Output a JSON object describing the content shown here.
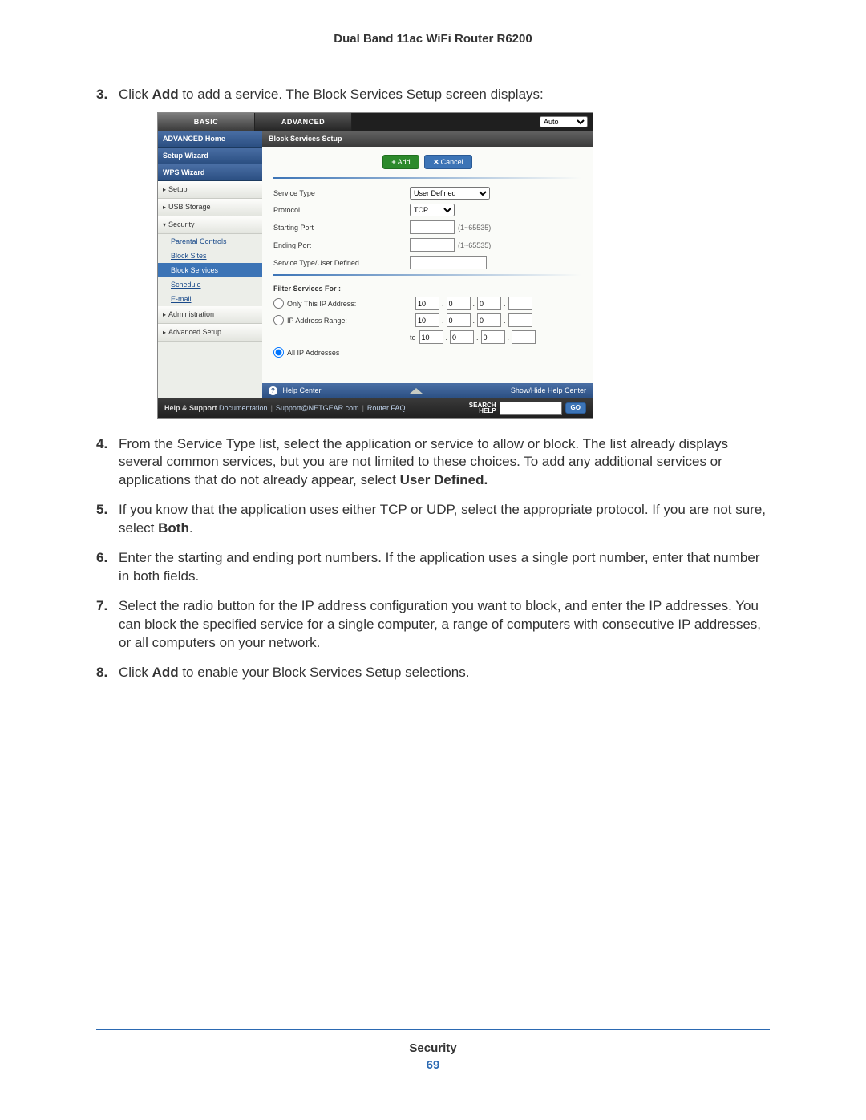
{
  "doc": {
    "title": "Dual Band 11ac WiFi Router R6200",
    "footer_section": "Security",
    "page_number": "69"
  },
  "steps": {
    "s3_num": "3.",
    "s3_a": "Click ",
    "s3_b": "Add",
    "s3_c": " to add a service. The Block Services Setup screen displays:",
    "s4_num": "4.",
    "s4_a": "From the Service Type list, select the application or service to allow or block. The list already displays several common services, but you are not limited to these choices. To add any additional services or applications that do not already appear, select ",
    "s4_b": "User Defined.",
    "s5_num": "5.",
    "s5_a": "If you know that the application uses either TCP or UDP, select the appropriate protocol. If you are not sure, select ",
    "s5_b": "Both",
    "s5_c": ".",
    "s6_num": "6.",
    "s6": "Enter the starting and ending port numbers. If the application uses a single port number, enter that number in both fields.",
    "s7_num": "7.",
    "s7": "Select the radio button for the IP address configuration you want to block, and enter the IP addresses. You can block the specified service for a single computer, a range of computers with consecutive IP addresses, or all computers on your network.",
    "s8_num": "8.",
    "s8_a": "Click ",
    "s8_b": "Add",
    "s8_c": " to enable your Block Services Setup selections."
  },
  "ui": {
    "tabs": {
      "basic": "BASIC",
      "advanced": "ADVANCED",
      "auto": "Auto"
    },
    "sidebar": {
      "adv_home": "ADVANCED Home",
      "setup_wizard": "Setup Wizard",
      "wps_wizard": "WPS Wizard",
      "setup": "Setup",
      "usb": "USB Storage",
      "security": "Security",
      "parental": "Parental Controls",
      "block_sites": "Block Sites",
      "block_services": "Block Services",
      "schedule": "Schedule",
      "email": "E-mail",
      "admin": "Administration",
      "adv_setup": "Advanced Setup"
    },
    "content": {
      "title": "Block Services Setup",
      "add_btn": "Add",
      "cancel_btn": "Cancel",
      "service_type": "Service Type",
      "service_type_value": "User Defined",
      "protocol": "Protocol",
      "protocol_value": "TCP",
      "starting_port": "Starting Port",
      "ending_port": "Ending Port",
      "port_hint": "(1~65535)",
      "service_user": "Service Type/User Defined",
      "filter_title": "Filter Services For :",
      "only_this_ip": "Only This IP Address:",
      "ip_range": "IP Address Range:",
      "to": "to",
      "all_ip": "All IP Addresses",
      "ip1": "10",
      "ip2": "0",
      "ip3": "0",
      "ip4": "",
      "r1_1": "10",
      "r1_2": "0",
      "r1_3": "0",
      "r1_4": "",
      "r2_1": "10",
      "r2_2": "0",
      "r2_3": "0",
      "r2_4": ""
    },
    "helpbar": {
      "help_center": "Help Center",
      "show_hide": "Show/Hide Help Center"
    },
    "footer": {
      "help_support": "Help & Support",
      "documentation": "Documentation",
      "support_link": "Support@NETGEAR.com",
      "router_faq": "Router FAQ",
      "search_help": "SEARCH HELP",
      "go": "GO"
    }
  }
}
